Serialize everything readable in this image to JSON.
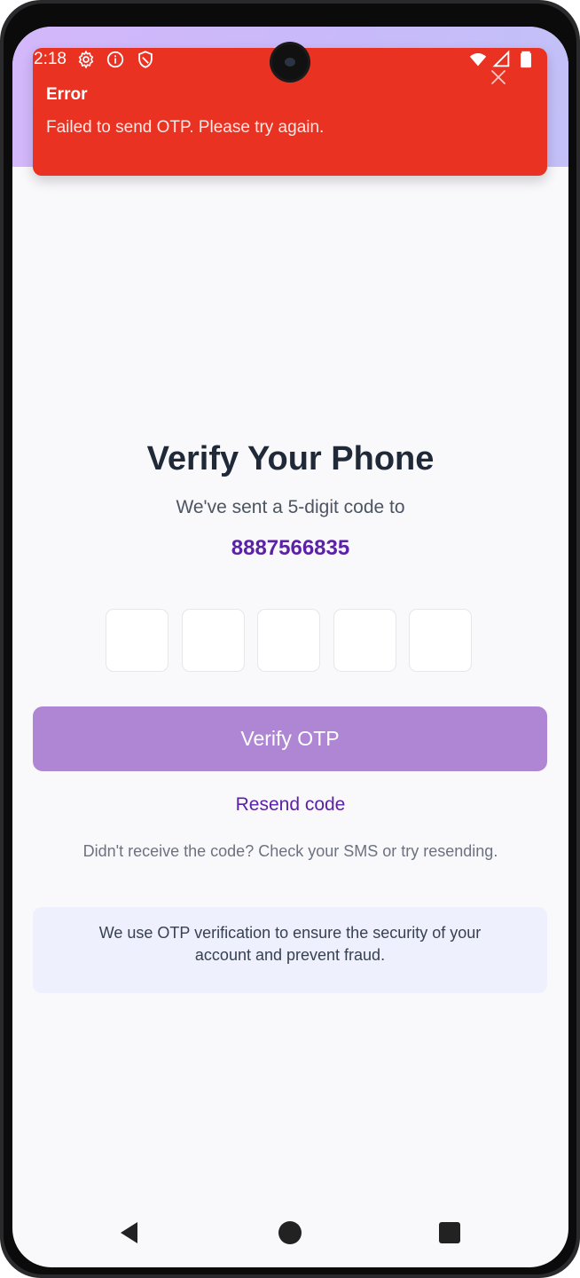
{
  "status_bar": {
    "time": "2:18",
    "left_icons": [
      "gear-icon",
      "info-icon",
      "shield-icon"
    ],
    "right_icons": [
      "wifi-icon",
      "signal-icon",
      "battery-icon"
    ]
  },
  "toast": {
    "title": "Error",
    "message": "Failed to send OTP. Please try again.",
    "close_icon": "close-icon",
    "color": "#ea3223"
  },
  "verify": {
    "title": "Verify Your Phone",
    "subtitle": "We've sent a 5-digit code to",
    "phone": "8887566835",
    "otp_digits": [
      "",
      "",
      "",
      "",
      ""
    ],
    "button_label": "Verify OTP",
    "resend_label": "Resend code",
    "help_text": "Didn't receive the code? Check your SMS or try resending.",
    "info_text": "We use OTP verification to ensure the security of your account and prevent fraud."
  },
  "colors": {
    "accent": "#5b21a6",
    "button": "#ae86d3",
    "info_bg": "#eef0fd"
  },
  "nav_bar": {
    "items": [
      "back-icon",
      "home-icon",
      "recents-icon"
    ]
  }
}
